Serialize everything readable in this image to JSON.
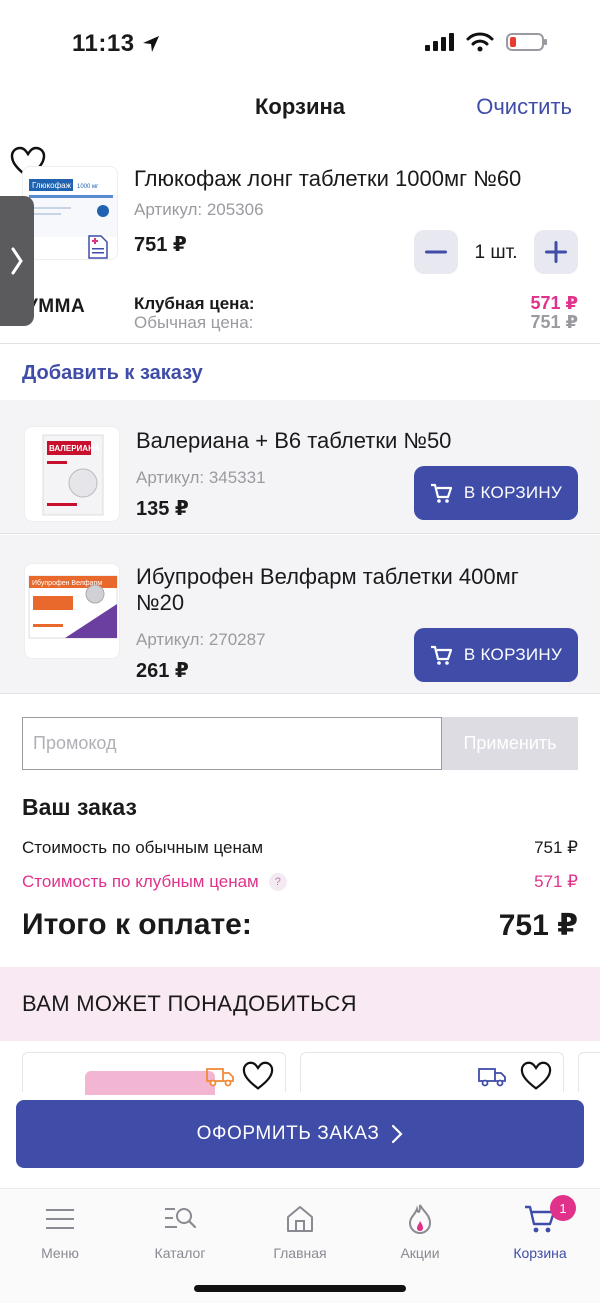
{
  "status": {
    "time": "11:13"
  },
  "header": {
    "title": "Корзина",
    "clear": "Очистить"
  },
  "cart_item": {
    "title": "Глюкофаж лонг таблетки 1000мг №60",
    "sku": "Артикул: 205306",
    "price": "751 ₽",
    "qty": "1 шт.",
    "summa": "СУММА",
    "club_label": "Клубная цена:",
    "club_value": "571 ₽",
    "regular_label": "Обычная цена:",
    "regular_value": "751 ₽"
  },
  "add_section": {
    "title": "Добавить к заказу"
  },
  "recommended": [
    {
      "title": "Валериана + В6 таблетки №50",
      "sku": "Артикул: 345331",
      "price": "135 ₽",
      "button": "В КОРЗИНУ"
    },
    {
      "title": "Ибупрофен Велфарм таблетки 400мг №20",
      "sku": "Артикул: 270287",
      "price": "261 ₽",
      "button": "В КОРЗИНУ"
    }
  ],
  "promo": {
    "placeholder": "Промокод",
    "apply": "Применить"
  },
  "order": {
    "title": "Ваш заказ",
    "regular_label": "Стоимость по обычным ценам",
    "regular_value": "751 ₽",
    "club_label": "Стоимость по клубным ценам",
    "club_help": "?",
    "club_value": "571 ₽",
    "total_label": "Итого к оплате:",
    "total_value": "751 ₽"
  },
  "maybe": {
    "title": "ВАМ МОЖЕТ ПОНАДОБИТЬСЯ"
  },
  "checkout": {
    "label": "ОФОРМИТЬ ЗАКАЗ"
  },
  "tabs": [
    {
      "label": "Меню",
      "icon": "menu-icon"
    },
    {
      "label": "Каталог",
      "icon": "catalog-icon"
    },
    {
      "label": "Главная",
      "icon": "home-icon"
    },
    {
      "label": "Акции",
      "icon": "promo-flame-icon"
    },
    {
      "label": "Корзина",
      "icon": "cart-icon",
      "badge": "1",
      "active": true
    }
  ],
  "colors": {
    "accent": "#3f4da8",
    "club": "#e0328a",
    "maybe_band": "#f9e9f2"
  },
  "product_images": {
    "item1": {
      "brand": "Глюкофаж лонг",
      "dose": "1000 мг"
    },
    "rec1": {
      "brand": "ВАЛЕРИАНА"
    },
    "rec2": {
      "brand": "Ибупрофен Велфарм"
    }
  }
}
